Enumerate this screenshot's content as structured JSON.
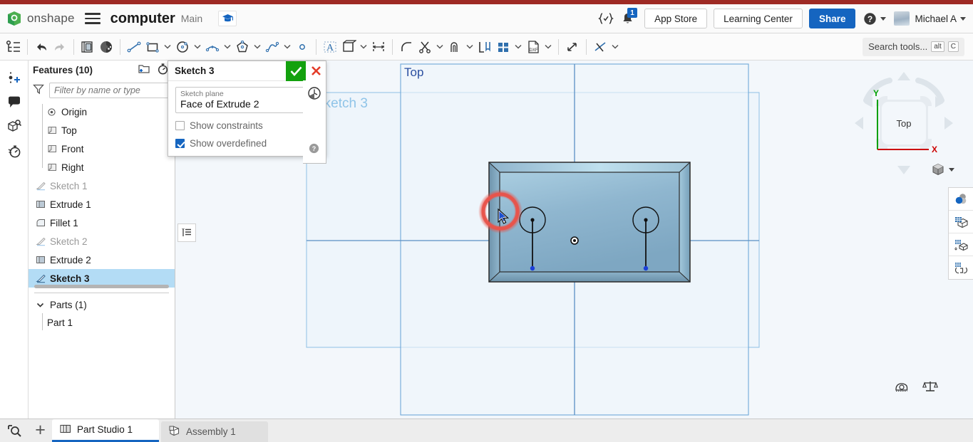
{
  "header": {
    "brand": "onshape",
    "brand_icon": "onshape-logo-icon",
    "menu_icon": "hamburger-menu-icon",
    "document_title": "computer",
    "branch": "Main",
    "graduation_icon": "graduation-cap-icon",
    "version_icon": "version-braces-icon",
    "notification_icon": "bell-icon",
    "notification_count": "1",
    "app_store_label": "App Store",
    "learning_center_label": "Learning Center",
    "share_label": "Share",
    "help_icon": "question-circle-icon",
    "avatar_name": "avatar",
    "user_name": "Michael A"
  },
  "toolbar": {
    "feature_list_icon": "feature-list-icon",
    "undo_icon": "undo-arrow-icon",
    "redo_icon": "redo-arrow-icon",
    "sketch_icon": "new-sketch-icon",
    "plane_icon": "plane-icon",
    "line_icon": "line-icon",
    "rectangle_icon": "rectangle-icon",
    "circle_icon": "circle-icon",
    "arc_icon": "arc-icon",
    "polygon_icon": "polygon-icon",
    "spline_icon": "spline-icon",
    "point_icon": "point-icon",
    "text_icon": "sketch-text-icon",
    "mirror_icon": "mirror-icon",
    "dimension_icon": "dimension-icon",
    "fillet_icon": "sketch-fillet-icon",
    "trim_icon": "trim-scissors-icon",
    "offset_icon": "offset-icon",
    "use_icon": "use-project-icon",
    "pattern_icon": "linear-pattern-icon",
    "dxf_icon": "dxf-import-icon",
    "transform_icon": "transform-icon",
    "constraint_icon": "constraint-icon",
    "search_placeholder": "Search tools...",
    "search_kbd_alt": "alt",
    "search_kbd_key": "C"
  },
  "rail": {
    "items": [
      {
        "icon": "insert-feature-icon",
        "name": "insert-feature"
      },
      {
        "icon": "comment-icon",
        "name": "comments"
      },
      {
        "icon": "part-search-icon",
        "name": "part-search"
      },
      {
        "icon": "history-stopwatch-icon",
        "name": "history"
      }
    ]
  },
  "tree": {
    "title": "Features (10)",
    "add_folder_icon": "add-folder-icon",
    "rollback_icon": "rollback-stopwatch-icon",
    "filter_icon": "filter-funnel-icon",
    "filter_placeholder": "Filter by name or type",
    "items": [
      {
        "label": "Origin",
        "icon": "origin-icon",
        "state": "child"
      },
      {
        "label": "Top",
        "icon": "plane-icon",
        "state": "child"
      },
      {
        "label": "Front",
        "icon": "plane-icon",
        "state": "child"
      },
      {
        "label": "Right",
        "icon": "plane-icon",
        "state": "child"
      },
      {
        "label": "Sketch 1",
        "icon": "sketch-icon",
        "state": "muted"
      },
      {
        "label": "Extrude 1",
        "icon": "extrude-icon",
        "state": "normal"
      },
      {
        "label": "Fillet 1",
        "icon": "fillet-icon",
        "state": "normal"
      },
      {
        "label": "Sketch 2",
        "icon": "sketch-icon",
        "state": "muted"
      },
      {
        "label": "Extrude 2",
        "icon": "extrude-icon",
        "state": "normal"
      },
      {
        "label": "Sketch 3",
        "icon": "sketch-icon",
        "state": "selected"
      }
    ],
    "parts_label": "Parts (1)",
    "parts_chevron_icon": "chevron-down-icon",
    "parts": [
      {
        "label": "Part 1"
      }
    ],
    "legend_icon": "legend-list-icon"
  },
  "dialog": {
    "title": "Sketch 3",
    "accept_icon": "check-icon",
    "cancel_icon": "x-close-icon",
    "plane_field_label": "Sketch plane",
    "plane_field_value": "Face of Extrude 2",
    "plane_clear_icon": "clear-x-icon",
    "show_constraints_label": "Show constraints",
    "show_constraints_checked": false,
    "show_overdefined_label": "Show overdefined",
    "show_overdefined_checked": true,
    "clock_icon": "sketch-clock-icon",
    "help_icon": "help-circle-icon"
  },
  "viewport": {
    "sketch_watermark": "Sketch 3",
    "top_plane_label": "Top",
    "origin_icon": "sketch-origin-icon",
    "cursor_icon": "mouse-cursor-icon",
    "highlight_color": "#e8534a",
    "part_fill": "#8fb6cf",
    "plane_outline_color": "#7fb4de",
    "axis_color": "#5a8fc4",
    "viewcube": {
      "face_label": "Top",
      "x_axis_label": "X",
      "y_axis_label": "Y",
      "x_axis_color": "#cc0000",
      "y_axis_color": "#00a000",
      "rotate_left_icon": "rotate-left-arrow-icon",
      "rotate_right_icon": "rotate-right-arrow-icon",
      "nav_up_icon": "nav-up-arrow-icon",
      "nav_down_icon": "nav-down-arrow-icon",
      "nav_left_icon": "nav-left-arrow-icon",
      "nav_right_icon": "nav-right-arrow-icon",
      "view_mode_icon": "view-cube-icon",
      "view_mode_caret_icon": "chevron-down-icon"
    },
    "right_tools": [
      {
        "icon": "display-state-icon",
        "name": "display-state"
      },
      {
        "icon": "section-view-icon",
        "name": "section-view"
      },
      {
        "icon": "explode-view-icon",
        "name": "explode-view"
      },
      {
        "icon": "render-view-icon",
        "name": "render-view"
      }
    ],
    "measure_icon": "measure-tape-icon",
    "mass-props_icon": "mass-properties-scale-icon"
  },
  "bottom": {
    "zoom_icon": "zoom-to-fit-icon",
    "add_tab_icon": "add-tab-plus-icon",
    "tabs": [
      {
        "label": "Part Studio 1",
        "icon": "part-studio-icon",
        "active": true
      },
      {
        "label": "Assembly 1",
        "icon": "assembly-icon",
        "active": false
      }
    ]
  }
}
